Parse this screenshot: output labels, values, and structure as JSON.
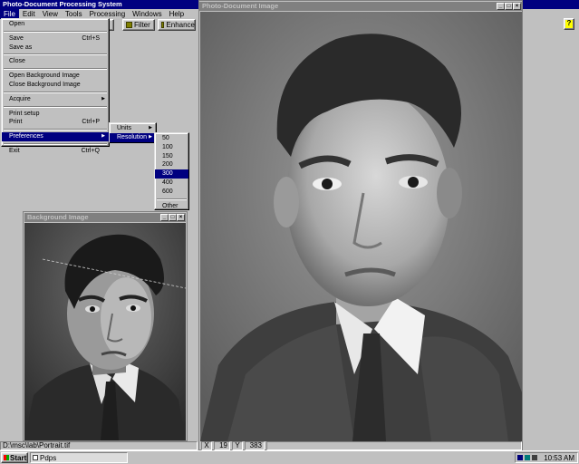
{
  "app": {
    "title": "Photo-Document Processing System",
    "menubar": [
      "File",
      "Edit",
      "View",
      "Tools",
      "Processing",
      "Windows",
      "Help"
    ],
    "toolbar": {
      "filter_label": "Filter",
      "enhance_label": "Enhance",
      "help_icon": "?"
    }
  },
  "file_menu": {
    "items": [
      {
        "label": "Open",
        "shortcut": ""
      },
      {
        "label": "Save",
        "shortcut": "Ctrl+S"
      },
      {
        "label": "Save as",
        "shortcut": ""
      },
      {
        "label": "Close",
        "shortcut": ""
      },
      {
        "label": "Open Background Image",
        "shortcut": ""
      },
      {
        "label": "Close Background Image",
        "shortcut": ""
      },
      {
        "label": "Acquire",
        "shortcut": ""
      },
      {
        "label": "Print setup",
        "shortcut": ""
      },
      {
        "label": "Print",
        "shortcut": "Ctrl+P"
      },
      {
        "label": "Preferences",
        "shortcut": ""
      },
      {
        "label": "Exit",
        "shortcut": "Ctrl+Q"
      }
    ]
  },
  "preferences_menu": {
    "items": [
      "Units",
      "Resolution"
    ]
  },
  "resolution_menu": {
    "items": [
      "50",
      "100",
      "150",
      "200",
      "300",
      "400",
      "600",
      "Other"
    ],
    "selected": "300"
  },
  "background_window": {
    "title": "Background Image"
  },
  "document_window": {
    "title": "Photo-Document Image",
    "status": {
      "x_label": "X",
      "x_value": "19",
      "y_label": "Y",
      "y_value": "383"
    }
  },
  "main_status": {
    "path": "D:\\msc\\lab\\Portrait.tif"
  },
  "taskbar": {
    "start_label": "Start",
    "task_label": "Pdps",
    "clock": "10:53 AM"
  },
  "colors": {
    "title_active": "#000080",
    "title_inactive": "#808080",
    "face": "#c0c0c0",
    "desktop": "#c0c0c0"
  }
}
